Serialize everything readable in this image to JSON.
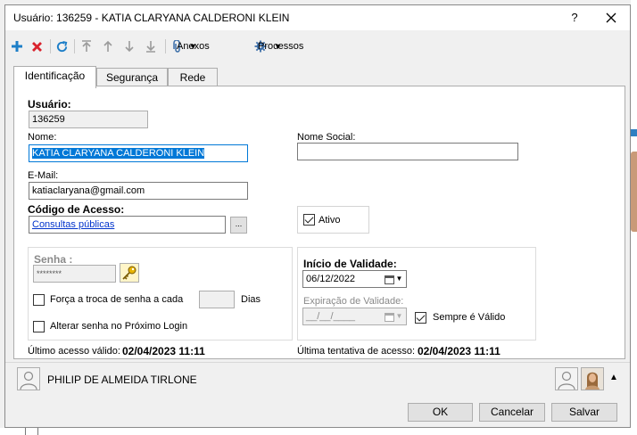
{
  "window": {
    "title": "Usuário: 136259 - KATIA CLARYANA CALDERONI KLEIN",
    "help": "?"
  },
  "toolbar": {
    "anexos": "Anexos",
    "processos": "Processos"
  },
  "tabs": [
    {
      "label": "Identificação"
    },
    {
      "label": "Segurança"
    },
    {
      "label": "Rede"
    }
  ],
  "form": {
    "usuario_label": "Usuário:",
    "usuario_value": "136259",
    "nome_label": "Nome:",
    "nome_value": "KATIA CLARYANA CALDERONI KLEIN",
    "nome_social_label": "Nome Social:",
    "nome_social_value": "",
    "email_label": "E-Mail:",
    "email_value": "katiaclaryana@gmail.com",
    "codigo_label": "Código de Acesso:",
    "codigo_value": "Consultas públicas",
    "browse_label": "...",
    "ativo_label": "Ativo",
    "ativo_checked": true,
    "senha_label": "Senha :",
    "senha_value": "********",
    "forca_label": "Força a troca de senha a cada",
    "forca_checked": false,
    "dias_value": "",
    "dias_label": "Dias",
    "alterar_label": "Alterar senha no Próximo Login",
    "alterar_checked": false,
    "inicio_label": "Início de Validade:",
    "inicio_value": "06/12/2022",
    "expiracao_label": "Expiração de Validade:",
    "expiracao_value": "__/__/____",
    "sempre_label": "Sempre é Válido",
    "sempre_checked": true,
    "ultimo_acesso_label": "Último acesso válido:",
    "ultimo_acesso_value": "02/04/2023 11:11",
    "ultima_tentativa_label": "Última tentativa de acesso:",
    "ultima_tentativa_value": "02/04/2023 11:11"
  },
  "footer": {
    "user_name": "PHILIP DE ALMEIDA TIRLONE",
    "ok": "OK",
    "cancelar": "Cancelar",
    "salvar": "Salvar"
  },
  "colors": {
    "accent": "#0078d7",
    "link": "#0033cc",
    "add": "#1e7fc8",
    "delete": "#d9232d"
  }
}
